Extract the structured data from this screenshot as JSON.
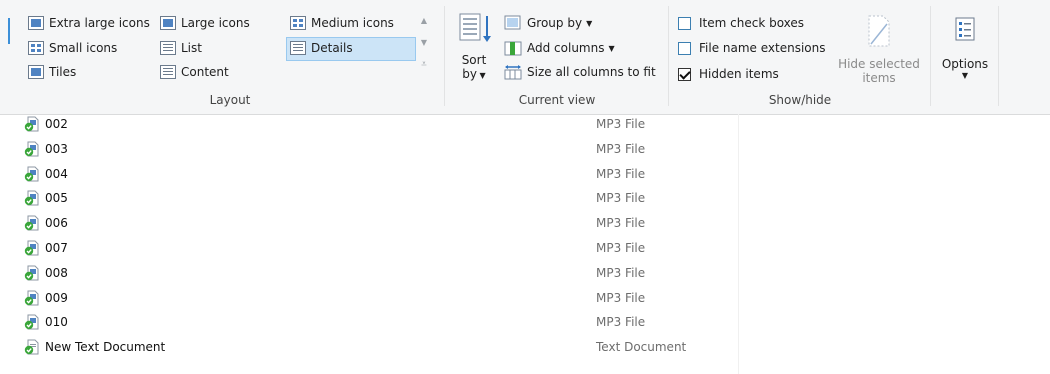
{
  "ribbon": {
    "layout": {
      "label": "Layout",
      "options": {
        "extra_large_icons": "Extra large icons",
        "large_icons": "Large icons",
        "medium_icons": "Medium icons",
        "small_icons": "Small icons",
        "list": "List",
        "details": "Details",
        "tiles": "Tiles",
        "content": "Content"
      },
      "selected": "Details"
    },
    "current_view": {
      "label": "Current view",
      "sort_by_line1": "Sort",
      "sort_by_line2": "by",
      "group_by": "Group by",
      "add_columns": "Add columns",
      "size_all_columns": "Size all columns to fit"
    },
    "show_hide": {
      "label": "Show/hide",
      "item_check_boxes": {
        "label": "Item check boxes",
        "checked": false
      },
      "file_name_extensions": {
        "label": "File name extensions",
        "checked": false
      },
      "hidden_items": {
        "label": "Hidden items",
        "checked": true
      },
      "hide_selected_line1": "Hide selected",
      "hide_selected_line2": "items"
    },
    "options": {
      "label": "Options"
    }
  },
  "files": [
    {
      "name": "002",
      "type": "MP3 File"
    },
    {
      "name": "003",
      "type": "MP3 File"
    },
    {
      "name": "004",
      "type": "MP3 File"
    },
    {
      "name": "005",
      "type": "MP3 File"
    },
    {
      "name": "006",
      "type": "MP3 File"
    },
    {
      "name": "007",
      "type": "MP3 File"
    },
    {
      "name": "008",
      "type": "MP3 File"
    },
    {
      "name": "009",
      "type": "MP3 File"
    },
    {
      "name": "010",
      "type": "MP3 File"
    },
    {
      "name": "New Text Document",
      "type": "Text Document"
    }
  ],
  "colors": {
    "ribbon_bg": "#f5f6f7",
    "selected_bg": "#cce4f7",
    "selected_border": "#99c9ef",
    "sync_green": "#3aa63a",
    "icon_blue": "#4f83c2"
  }
}
